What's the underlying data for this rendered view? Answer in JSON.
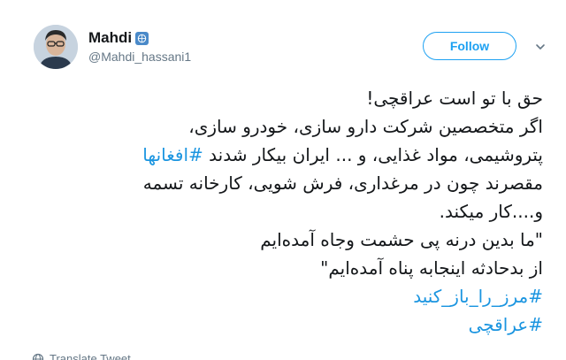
{
  "user": {
    "display_name": "Mahdi",
    "handle": "@Mahdi_hassani1"
  },
  "follow_button": {
    "label": "Follow"
  },
  "tweet": {
    "line1": "حق با تو است عراقچی!",
    "line2": "اگر متخصصین شرکت دارو سازی، خودرو  سازی،",
    "line3_text": "پتروشیمی، مواد غذایی، و ... ایران بیکار شدند ",
    "line3_hashtag": "#افغانها",
    "line4": "مقصرند چون در مرغداری، فرش شویی، کارخانه تسمه",
    "line5": "و....کار میکند.",
    "line6": "\"ما بدین درنه پی حشمت وجاه آمده‌ایم",
    "line7": "از بدحادثه اینجابه پناه آمده‌ایم\"",
    "hashtag1": "#مرز_را_باز_کنید",
    "hashtag2": "#عراقچی"
  },
  "translate": {
    "label": "Translate Tweet"
  },
  "colors": {
    "accent": "#1da1f2",
    "hashtag": "#1b95e0",
    "text": "#14171a",
    "secondary": "#657786"
  },
  "icons": [
    "verified-un-badge-icon",
    "chevron-down-icon",
    "globe-icon"
  ]
}
